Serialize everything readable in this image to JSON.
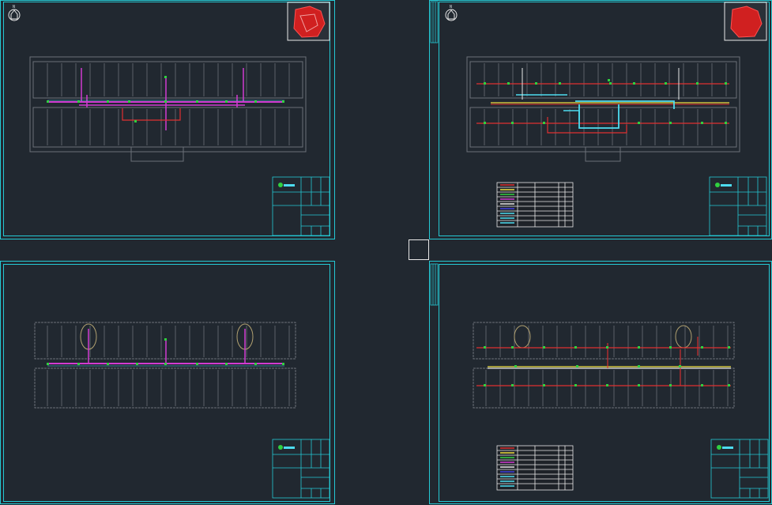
{
  "viewport": {
    "background": "#212830",
    "cursor": "crosshair-pickbox"
  },
  "colors": {
    "frame": "#25c9d4",
    "wall": "#6b7078",
    "supply": "#d13ad1",
    "return": "#e03030",
    "water": "#4ddcf0",
    "hot": "#f0e040",
    "node": "#30d040",
    "white": "#e8e8e8"
  },
  "sheets": [
    {
      "id": "sheet-1",
      "north_label": "N",
      "legend": false,
      "side_strip": false
    },
    {
      "id": "sheet-2",
      "north_label": "N",
      "legend": true,
      "side_strip": true
    },
    {
      "id": "sheet-3",
      "north_label": "",
      "legend": false,
      "side_strip": false
    },
    {
      "id": "sheet-4",
      "north_label": "",
      "legend": true,
      "side_strip": true
    }
  ],
  "icons": [
    "north-arrow-icon",
    "site-key-plan-icon",
    "company-logo-icon"
  ]
}
